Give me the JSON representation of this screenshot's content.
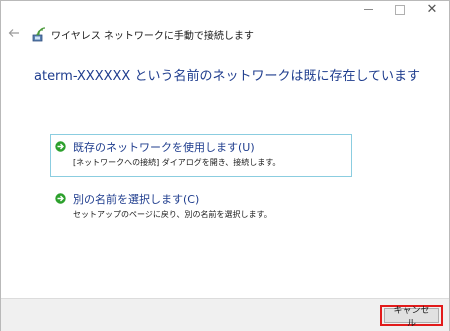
{
  "window": {
    "title_icon": "wireless-network-icon",
    "back_icon": "back-arrow-icon",
    "header_title": "ワイヤレス ネットワークに手動で接続します"
  },
  "main": {
    "heading": "aterm-XXXXXX という名前のネットワークは既に存在しています"
  },
  "options": [
    {
      "icon": "green-arrow-icon",
      "title": "既存のネットワークを使用します(U)",
      "description": "[ネットワークへの接続] ダイアログを開き、接続します。"
    },
    {
      "icon": "green-arrow-icon",
      "title": "別の名前を選択します(C)",
      "description": "セットアップのページに戻り、別の名前を選択します。"
    }
  ],
  "footer": {
    "cancel_label": "キャンセル"
  },
  "colors": {
    "heading": "#1f3d8e",
    "option_border": "#8bcde0",
    "arrow_green": "#2ca02c",
    "highlight_red": "#e21b1b",
    "footer_bg": "#f0f0f0"
  }
}
